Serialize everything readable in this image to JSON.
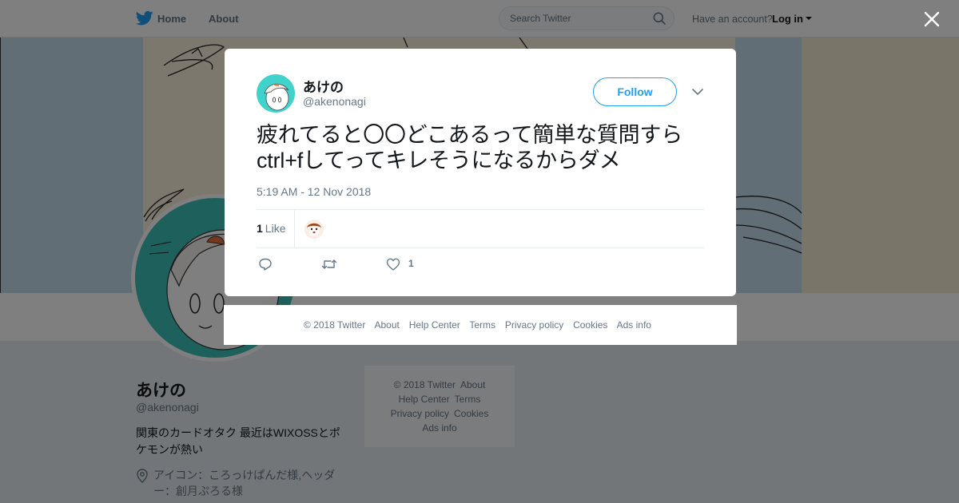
{
  "topbar": {
    "home_label": "Home",
    "about_label": "About",
    "search_placeholder": "Search Twitter",
    "have_account": "Have an account?",
    "login_label": "Log in",
    "brand_color": "#1da1f2"
  },
  "profile": {
    "name": "あけの",
    "handle": "@akenonagi",
    "bio": "関東のカードオタク 最近はWIXOSSとポケモンが熱い",
    "location": "アイコン：ころっけぱんだ様,ヘッダー：創月ぷろる様"
  },
  "side_footer": {
    "line1": [
      "© 2018 Twitter",
      "About"
    ],
    "line2": [
      "Help Center",
      "Terms"
    ],
    "line3": [
      "Privacy policy",
      "Cookies"
    ],
    "line4": [
      "Ads info"
    ]
  },
  "tweet": {
    "name": "あけの",
    "handle": "@akenonagi",
    "follow_label": "Follow",
    "text": "疲れてると〇〇どこあるって簡単な質問すらctrl+fしてってキレそうになるからダメ",
    "timestamp": "5:19 AM - 12 Nov 2018",
    "likes_count": "1",
    "likes_label": "Like",
    "action_like_count": "1"
  },
  "modal_footer": {
    "links": [
      "© 2018 Twitter",
      "About",
      "Help Center",
      "Terms",
      "Privacy policy",
      "Cookies",
      "Ads info"
    ]
  },
  "icons": {
    "logo": "twitter-bird-icon",
    "search": "search-icon",
    "close": "close-icon",
    "chevron": "chevron-down-icon",
    "reply": "reply-icon",
    "retweet": "retweet-icon",
    "like": "heart-icon",
    "location": "location-pin-icon"
  }
}
